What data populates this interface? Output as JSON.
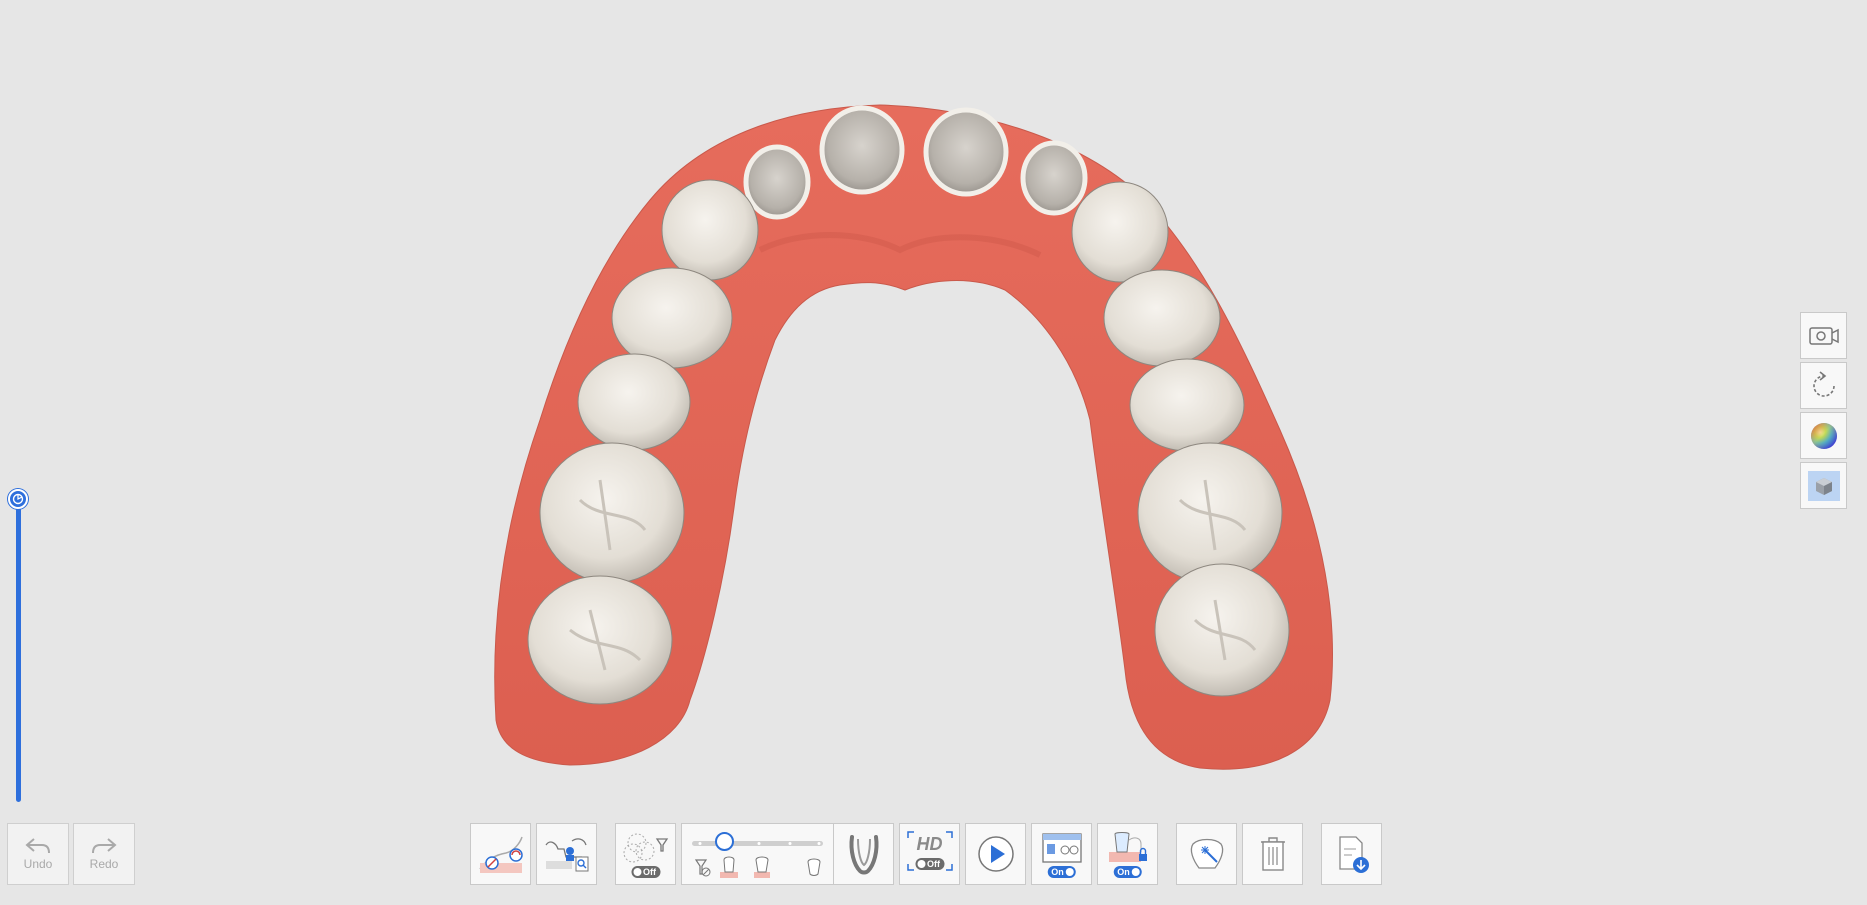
{
  "toolbar": {
    "undo_label": "Undo",
    "redo_label": "Redo",
    "data_filter_toggle": "Off",
    "hd_label": "HD",
    "hd_toggle": "Off",
    "ai_scan_toggle": "On",
    "lock_toggle": "On"
  },
  "filter_slider": {
    "level": 0.25
  },
  "colors": {
    "background": "#e6e6e6",
    "accent": "#2e6fdc",
    "gum": "#e2685a",
    "tooth": "#ece8df"
  },
  "icons": {
    "undo": "undo-arrow-icon",
    "redo": "redo-arrow-icon",
    "tissue": "smart-tissue-icon",
    "inspect": "inspection-icon",
    "filter": "data-filter-icon",
    "arch": "arch-icon",
    "play": "play-icon",
    "camera": "camera-icon",
    "rotate": "rotate-icon",
    "color": "color-wheel-icon",
    "cube": "cube-icon",
    "trash": "trash-icon",
    "export": "export-document-icon"
  }
}
